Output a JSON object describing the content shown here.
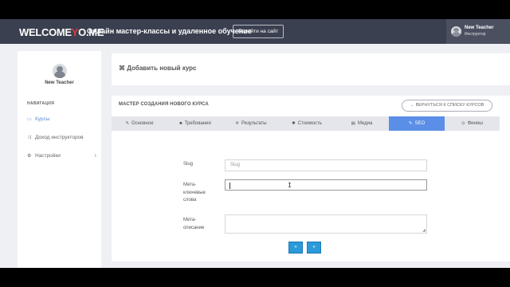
{
  "header": {
    "logo_part1": "WELCOME",
    "logo_part2": "Y",
    "logo_part3": "O.ME",
    "tagline": "Онлайн мастер-классы и удаленное обучение",
    "site_button": "Перейти на сайт",
    "user_name": "New Teacher",
    "user_role": "Инструктор"
  },
  "sidebar": {
    "user_name": "New Teacher",
    "nav_title": "НАВИГАЦИЯ",
    "items": [
      {
        "label": "Курсы",
        "icon": "book-icon",
        "active": true
      },
      {
        "label": "Доход инструкторов",
        "icon": "shuffle-icon",
        "active": false
      },
      {
        "label": "Настройки",
        "icon": "gear-icon",
        "active": false,
        "has_submenu": true
      }
    ]
  },
  "main": {
    "page_title": "Добавить новый курс",
    "wizard_title": "МАСТЕР СОЗДАНИЯ НОВОГО КУРСА",
    "back_button": "← ВЕРНУТЬСЯ К СПИСКУ КУРСОВ",
    "tabs": [
      {
        "label": "Основное",
        "icon": "✎"
      },
      {
        "label": "Требования",
        "icon": "■"
      },
      {
        "label": "Результаты",
        "icon": "✛"
      },
      {
        "label": "Стоимость",
        "icon": "✱"
      },
      {
        "label": "Медиа",
        "icon": "▤"
      },
      {
        "label": "SEO",
        "icon": "✎"
      },
      {
        "label": "Финиш",
        "icon": "⊙"
      }
    ],
    "active_tab": "SEO",
    "fields": {
      "slug_label": "Slug",
      "slug_placeholder": "Slug",
      "slug_value": "",
      "keywords_label_1": "Мета-",
      "keywords_label_2": "ключевые",
      "keywords_label_3": "слова",
      "keywords_value": "",
      "description_label_1": "Мета-",
      "description_label_2": "описание",
      "description_value": ""
    },
    "prev_button": "«",
    "next_button": "»"
  },
  "colors": {
    "header_bg": "#3a4050",
    "accent": "#5b8ee6",
    "button": "#2b9ad8",
    "logo_highlight": "#e03b3b"
  }
}
